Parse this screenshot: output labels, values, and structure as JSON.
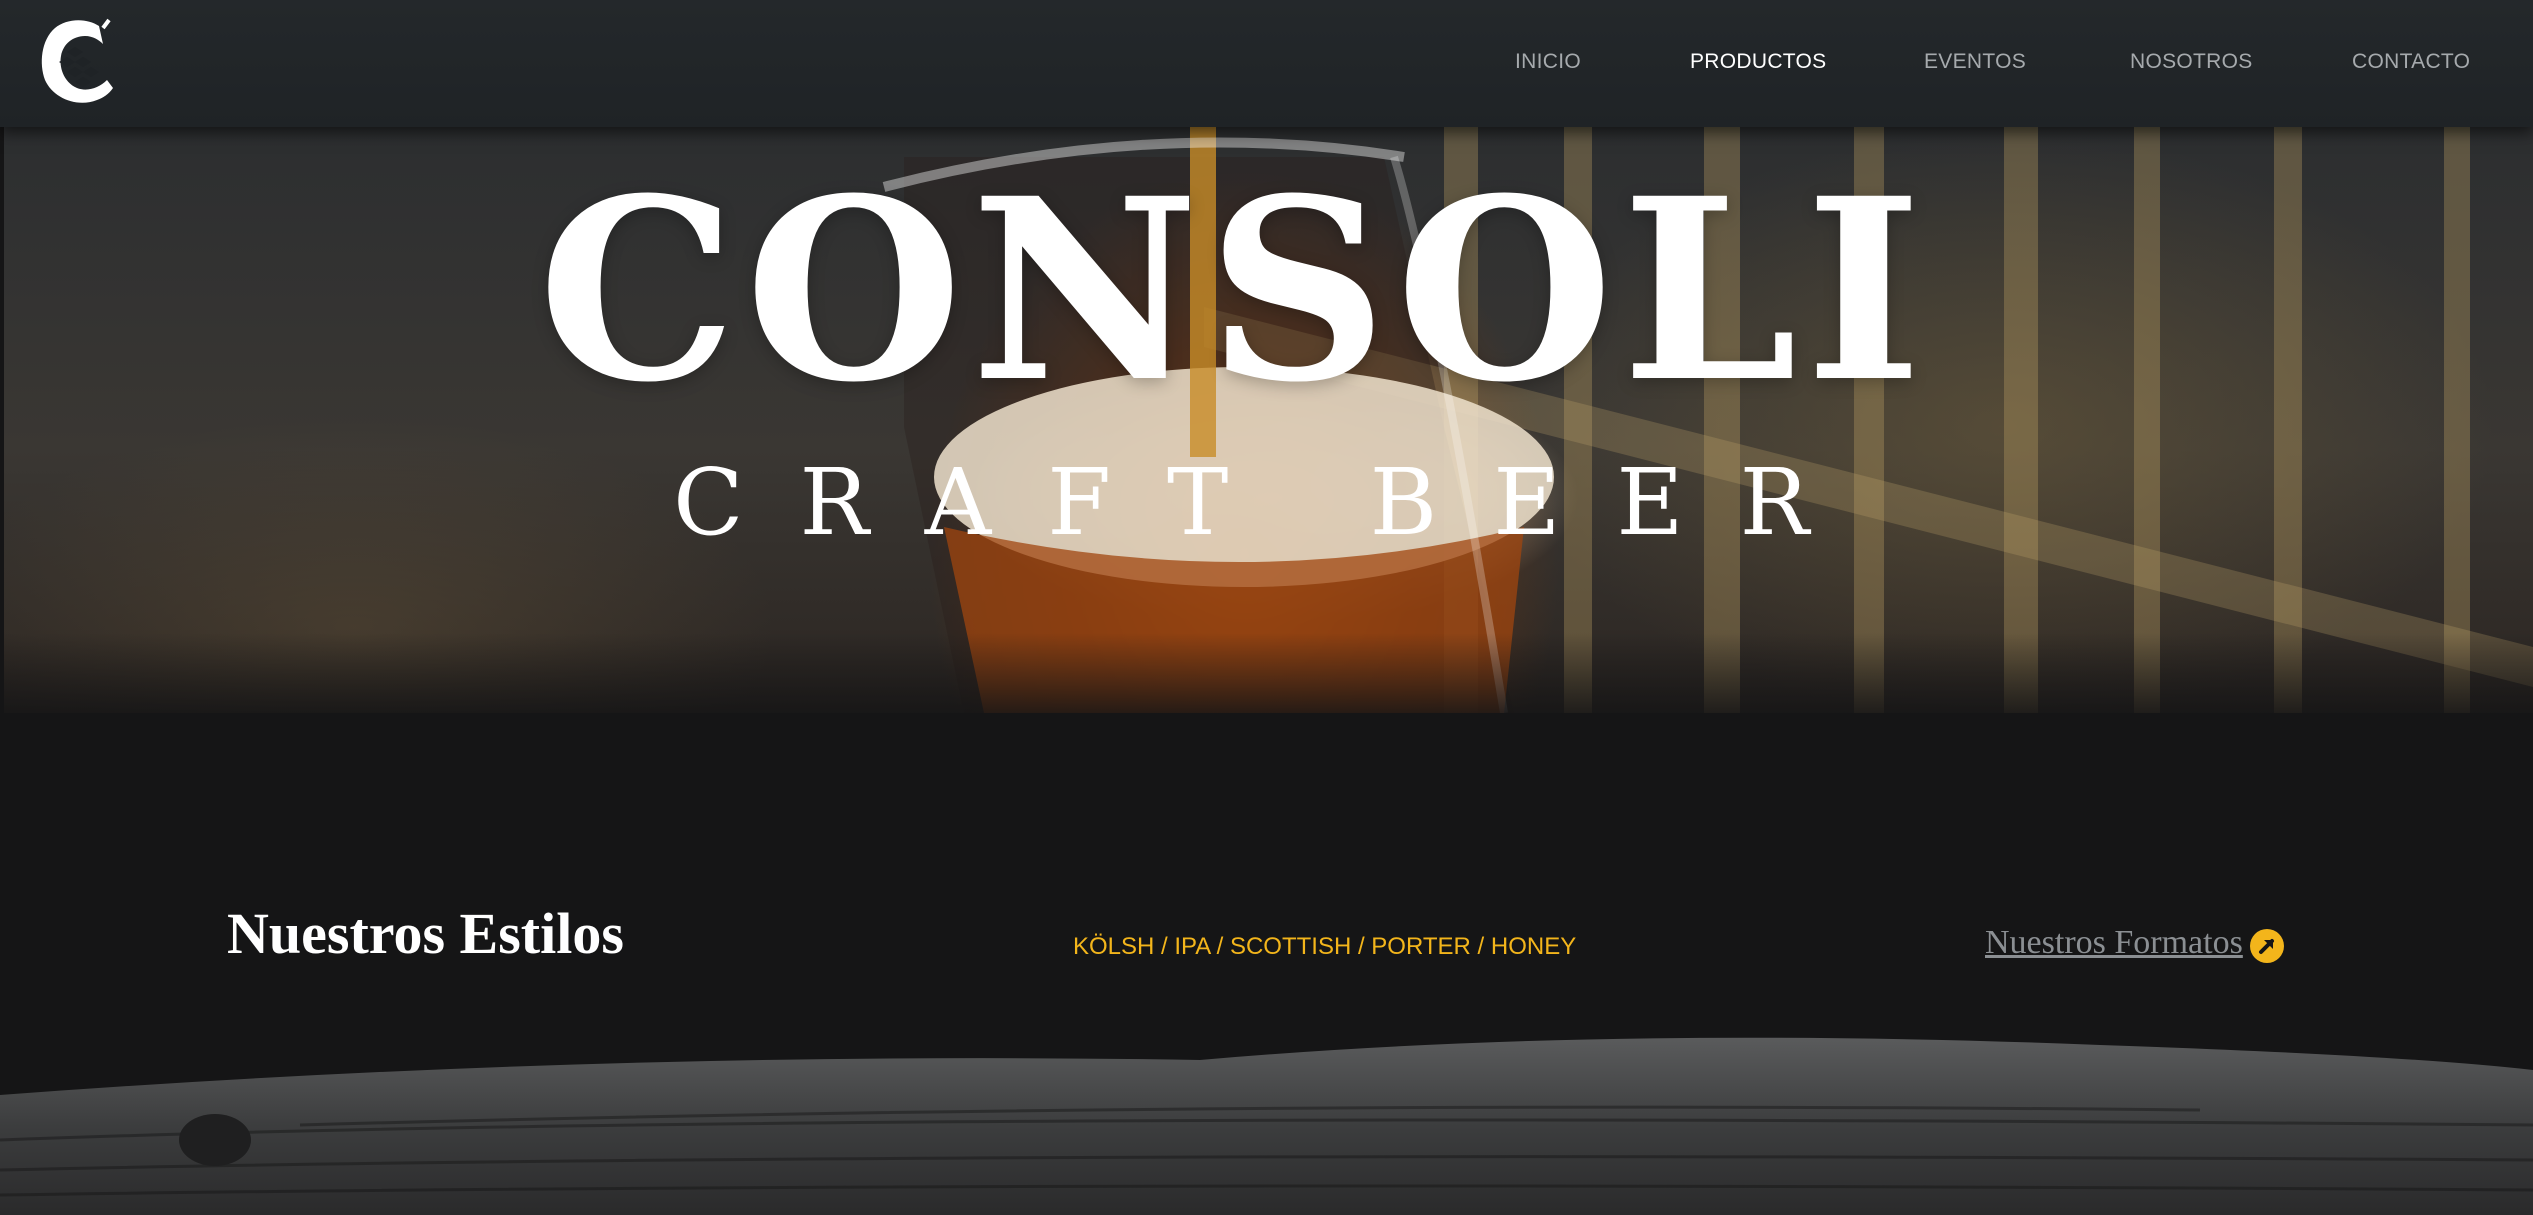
{
  "brand": {
    "logo_icon": "hop-c-logo-icon"
  },
  "nav": {
    "items": [
      {
        "label": "INICIO",
        "active": false
      },
      {
        "label": "PRODUCTOS",
        "active": true
      },
      {
        "label": "EVENTOS",
        "active": false
      },
      {
        "label": "NOSOTROS",
        "active": false
      },
      {
        "label": "CONTACTO",
        "active": false
      }
    ]
  },
  "hero": {
    "title": "CONSOLI",
    "subtitle": "CRAFT BEER"
  },
  "styles": {
    "heading": "Nuestros Estilos",
    "list": "KÖLSH / IPA / SCOTTISH / PORTER / HONEY",
    "formats_link": "Nuestros Formatos",
    "formats_icon": "arrow-up-right-circle-icon"
  },
  "colors": {
    "accent": "#f3b51b",
    "navbar": "#24282b",
    "page_background": "#151516",
    "nav_text": "#a6aaad",
    "link_text": "#8b8f93"
  }
}
